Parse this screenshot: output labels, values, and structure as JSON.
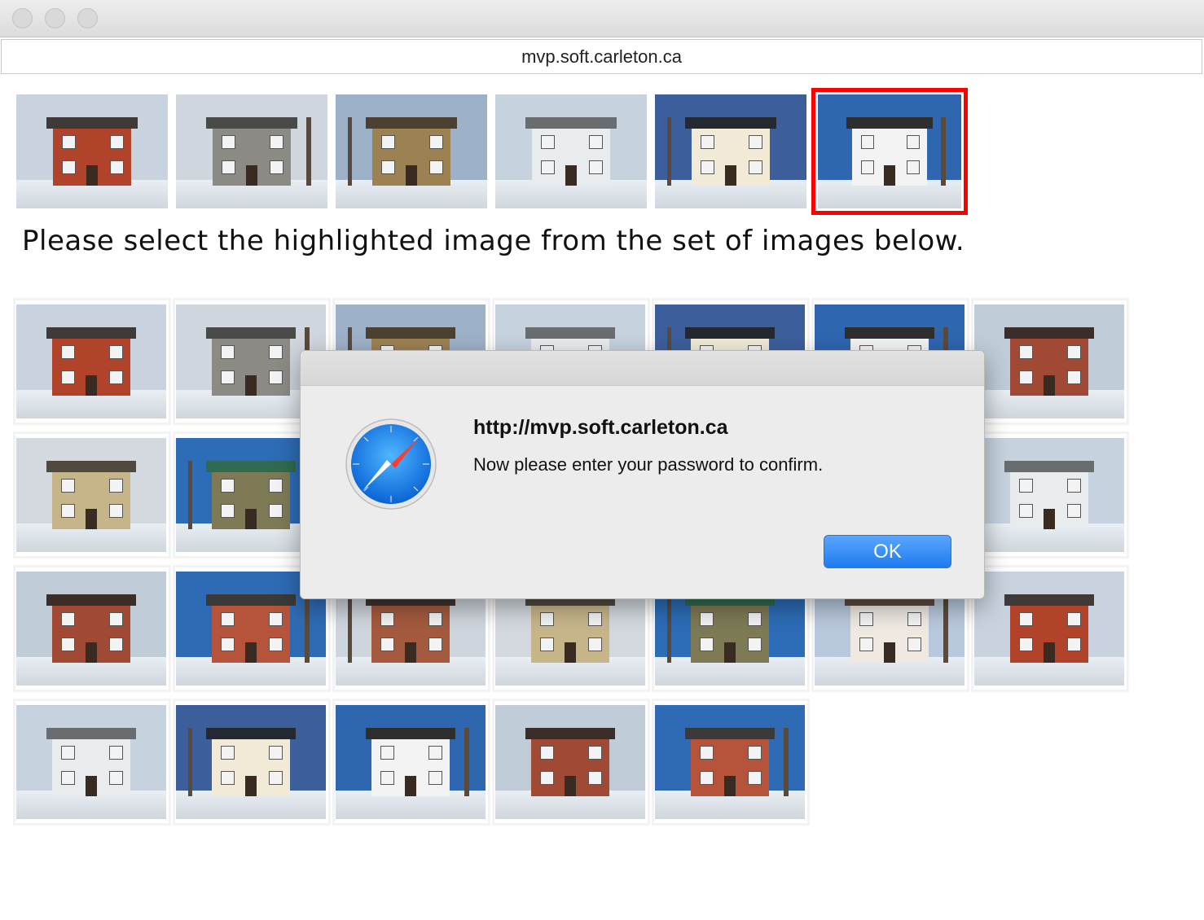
{
  "window": {
    "url": "mvp.soft.carleton.ca"
  },
  "instruction": "Please select the highlighted image from the set of images below.",
  "dialog": {
    "title": "http://mvp.soft.carleton.ca",
    "message": "Now please enter your password to confirm.",
    "ok_label": "OK",
    "icon": "safari-compass-icon"
  },
  "colors": {
    "highlight": "#ff0000",
    "ok_button": "#1e7bf0"
  }
}
